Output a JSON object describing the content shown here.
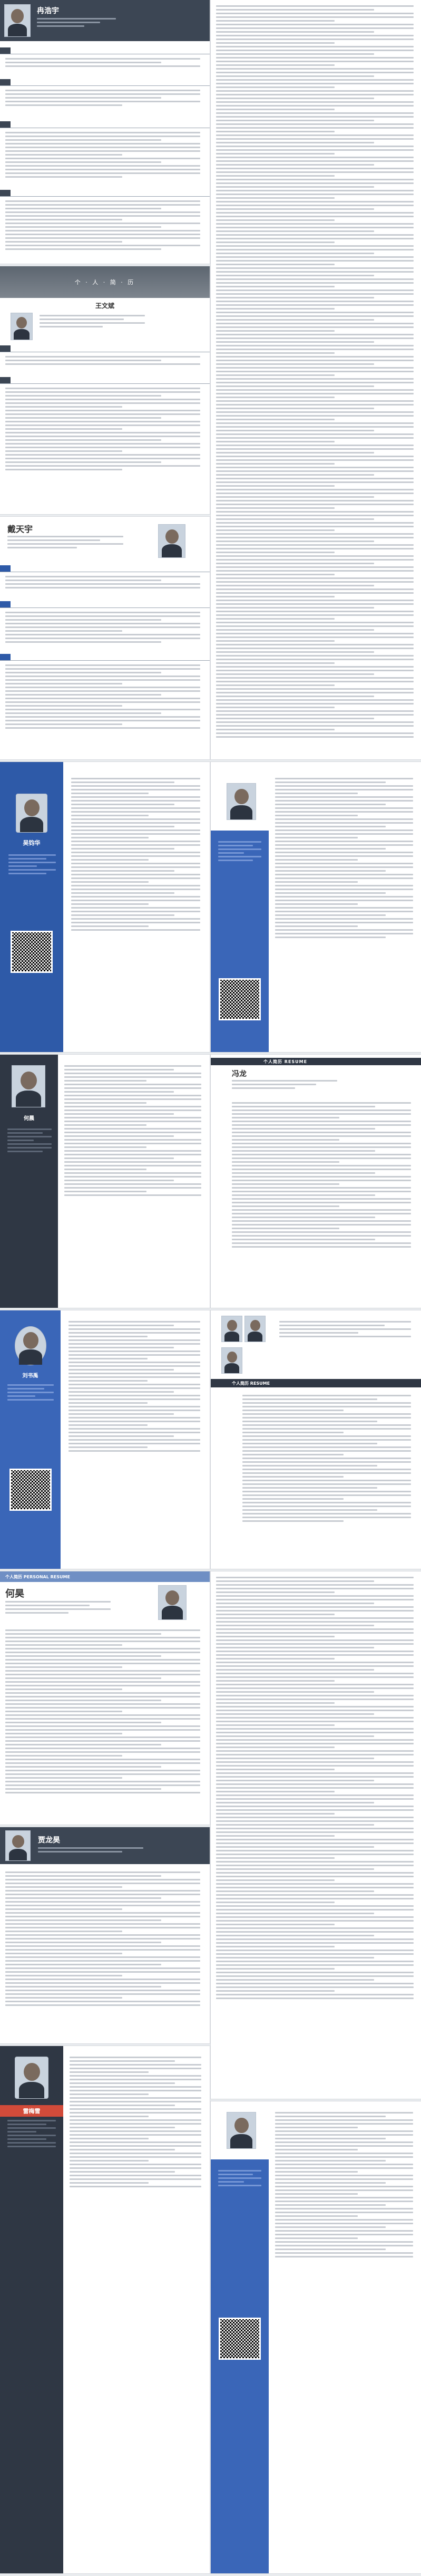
{
  "resumes": {
    "r1": {
      "name": "冉浩宇"
    },
    "r2": {
      "banner": "个 · 人 · 简 · 历",
      "name": "王文斌"
    },
    "r3": {
      "name": "戴天宇"
    },
    "r4": {
      "name": "吴钧华"
    },
    "r5": {
      "name": "何晨"
    },
    "r6": {
      "name": "冯龙",
      "banner": "个人简历 RESUME"
    },
    "r7": {
      "name": "刘书禹"
    },
    "r8": {
      "banner": "个人简历 RESUME"
    },
    "r9": {
      "banner": "个人简历 PERSONAL RESUME",
      "name": "何昊"
    },
    "r10": {
      "name": "贾龙昊"
    },
    "r11": {
      "name": "雷梅雪"
    }
  },
  "colors": {
    "dark": "#3c4654",
    "blue": "#2e5aa8",
    "sidebar": "#2f3744"
  }
}
